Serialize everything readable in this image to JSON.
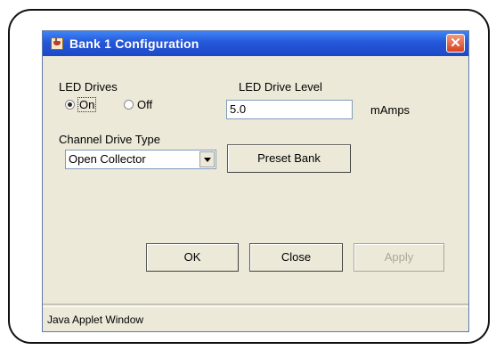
{
  "window": {
    "title": "Bank 1 Configuration",
    "close_symbol": "✕",
    "status_text": "Java Applet Window"
  },
  "led_drives": {
    "label": "LED Drives",
    "on_label": "On",
    "off_label": "Off",
    "selected": "On"
  },
  "led_drive_level": {
    "label": "LED Drive Level",
    "value": "5.0",
    "unit": "mAmps"
  },
  "channel_drive_type": {
    "label": "Channel Drive Type",
    "selected": "Open Collector"
  },
  "buttons": {
    "preset_bank": "Preset Bank",
    "ok": "OK",
    "close": "Close",
    "apply": "Apply"
  },
  "icons": [
    "java-applet-icon",
    "close-icon",
    "chevron-down-icon"
  ],
  "colors": {
    "titlebar": "#2457d8",
    "window_bg": "#ece9d8",
    "close_button": "#d8401e",
    "disabled_text": "#aca899"
  }
}
